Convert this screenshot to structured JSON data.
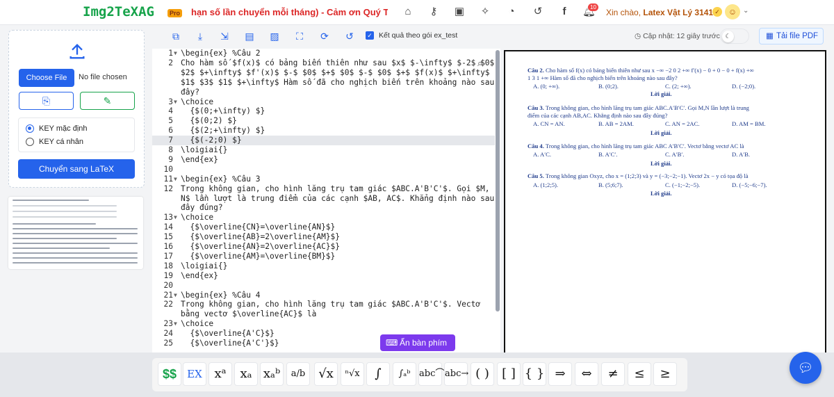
{
  "header": {
    "logo": "Img2TeXAG",
    "pro_badge": "Pro",
    "marquee": "hạn số lần chuyển mỗi tháng) - Cảm ơn Quý Thầy/C",
    "notification_count": "10",
    "greeting_prefix": "Xin chào, ",
    "greeting_name": "Latex Vật Lý 31415"
  },
  "upload": {
    "choose_label": "Choose File",
    "file_status": "No file chosen",
    "key_default": "KEY mặc định",
    "key_personal": "KEY cá nhân",
    "convert_label": "Chuyển sang LaTeX"
  },
  "toolbar": {
    "checkbox_label": "Kết quả theo gói ex_test",
    "updated_text": "Cập nhật: 12 giây trước",
    "pdf_label": "Tải file PDF"
  },
  "editor": {
    "rows": [
      {
        "n": "1",
        "fold": true,
        "code": "\\begin{ex} %Câu 2"
      },
      {
        "n": "2",
        "fold": false,
        "code": "Cho hàm số $f(x)$ có bảng biến thiên như sau $x$ $-\\infty$ $-2$ $0$"
      },
      {
        "n": "",
        "fold": false,
        "code": "$2$ $+\\infty$ $f'(x)$ $-$ $0$ $+$ $0$ $-$ $0$ $+$ $f(x)$ $+\\infty$"
      },
      {
        "n": "",
        "fold": false,
        "code": "$1$ $3$ $1$ $+\\infty$ Hàm số đã cho nghịch biến trên khoảng nào sau"
      },
      {
        "n": "",
        "fold": false,
        "code": "đây?"
      },
      {
        "n": "3",
        "fold": true,
        "code": "\\choice"
      },
      {
        "n": "4",
        "fold": false,
        "code": "  {$(0;+\\infty) $}"
      },
      {
        "n": "5",
        "fold": false,
        "code": "  {$(0;2) $}"
      },
      {
        "n": "6",
        "fold": false,
        "code": "  {$(2;+\\infty) $}"
      },
      {
        "n": "7",
        "fold": false,
        "code": "  {$(-2;0) $}",
        "hl": true
      },
      {
        "n": "8",
        "fold": false,
        "code": "\\loigiai{}"
      },
      {
        "n": "9",
        "fold": false,
        "code": "\\end{ex}"
      },
      {
        "n": "10",
        "fold": false,
        "code": ""
      },
      {
        "n": "11",
        "fold": true,
        "code": "\\begin{ex} %Câu 3"
      },
      {
        "n": "12",
        "fold": false,
        "code": "Trong không gian, cho hình lăng trụ tam giác $ABC.A'B'C'$. Gọi $M,"
      },
      {
        "n": "",
        "fold": false,
        "code": "N$ lần lượt là trung điểm của các cạnh $AB, AC$. Khẳng định nào sau"
      },
      {
        "n": "",
        "fold": false,
        "code": "đây đúng?"
      },
      {
        "n": "13",
        "fold": true,
        "code": "\\choice"
      },
      {
        "n": "14",
        "fold": false,
        "code": "  {$\\overline{CN}=\\overline{AN}$}"
      },
      {
        "n": "15",
        "fold": false,
        "code": "  {$\\overline{AB}=2\\overline{AM}$}"
      },
      {
        "n": "16",
        "fold": false,
        "code": "  {$\\overline{AN}=2\\overline{AC}$}"
      },
      {
        "n": "17",
        "fold": false,
        "code": "  {$\\overline{AM}=\\overline{BM}$}"
      },
      {
        "n": "18",
        "fold": false,
        "code": "\\loigiai{}"
      },
      {
        "n": "19",
        "fold": false,
        "code": "\\end{ex}"
      },
      {
        "n": "20",
        "fold": false,
        "code": ""
      },
      {
        "n": "21",
        "fold": true,
        "code": "\\begin{ex} %Câu 4"
      },
      {
        "n": "22",
        "fold": false,
        "code": "Trong không gian, cho hình lăng trụ tam giác $ABC.A'B'C'$. Vectơ"
      },
      {
        "n": "",
        "fold": false,
        "code": "bằng vectơ $\\overline{AC}$ là"
      },
      {
        "n": "23",
        "fold": true,
        "code": "\\choice"
      },
      {
        "n": "24",
        "fold": false,
        "code": "  {$\\overline{A'C}$}"
      },
      {
        "n": "25",
        "fold": false,
        "code": "  {$\\overline{A'C'}$}"
      }
    ]
  },
  "preview": {
    "q2_label": "Câu 2.",
    "q2_text1": "Cho hàm số f(x) có bảng biến thiên như sau x −∞ −2 0 2 +∞ f′(x) − 0 + 0 − 0 + f(x) +∞",
    "q2_text2": "1 3 1 +∞ Hàm số đã cho nghịch biến trên khoảng nào sau đây?",
    "q2_choices": [
      "A. (0; +∞).",
      "B. (0;2).",
      "C. (2; +∞).",
      "D. (−2;0)."
    ],
    "solution": "Lời giải.",
    "q3_label": "Câu 3.",
    "q3_text1": "Trong không gian, cho hình lăng trụ tam giác ABC.A′B′C′. Gọi M,N lần lượt là trung",
    "q3_text2": "điểm của các cạnh AB,AC. Khẳng định nào sau đây đúng?",
    "q3_choices": [
      "A. CN = AN.",
      "B. AB = 2AM.",
      "C. AN = 2AC.",
      "D. AM = BM."
    ],
    "q4_label": "Câu 4.",
    "q4_text": "Trong không gian, cho hình lăng trụ tam giác ABC A′B′C′. Vectơ bằng vectơ AC là",
    "q4_choices": [
      "A. A′C.",
      "B. A′C′.",
      "C. A′B′.",
      "D. A′B."
    ],
    "q5_label": "Câu 5.",
    "q5_text": "Trong không gian Oxyz, cho x = (1;2;3) và y = (−3;−2;−1). Vectơ 2x − y có tọa độ là",
    "q5_choices": [
      "A. (1;2;5).",
      "B. (5;6;7).",
      "C. (−1;−2;−5).",
      "D. (−5;−6;−7)."
    ]
  },
  "keyboard": {
    "hide_label": "Ẩn bàn phím",
    "keys": [
      {
        "name": "dollar-key",
        "label": "$$"
      },
      {
        "name": "ex-key",
        "label": "EX"
      },
      {
        "name": "superscript-key",
        "label": "xᵃ"
      },
      {
        "name": "subscript-key",
        "label": "xₐ"
      },
      {
        "name": "sub-super-key",
        "label": "xₐᵇ"
      },
      {
        "name": "fraction-key",
        "label": "a/b"
      },
      {
        "name": "sqrt-key",
        "label": "√x"
      },
      {
        "name": "nroot-key",
        "label": "ⁿ√x"
      },
      {
        "name": "integral-key",
        "label": "∫"
      },
      {
        "name": "definite-integral-key",
        "label": "∫ₐᵇ"
      },
      {
        "name": "arc-key",
        "label": "abc⌒"
      },
      {
        "name": "vector-key",
        "label": "abc→"
      },
      {
        "name": "parentheses-key",
        "label": "( )"
      },
      {
        "name": "brackets-key",
        "label": "[ ]"
      },
      {
        "name": "braces-key",
        "label": "{ }"
      },
      {
        "name": "implies-key",
        "label": "⇒"
      },
      {
        "name": "iff-key",
        "label": "⇔"
      },
      {
        "name": "not-equal-key",
        "label": "≠"
      },
      {
        "name": "leq-key",
        "label": "≤"
      },
      {
        "name": "geq-key",
        "label": "≥"
      }
    ]
  },
  "colors": {
    "accent": "#2563eb",
    "logo_green": "#16a34a",
    "marquee_red": "#dc2626",
    "keyboard_purple": "#7c3aed"
  }
}
